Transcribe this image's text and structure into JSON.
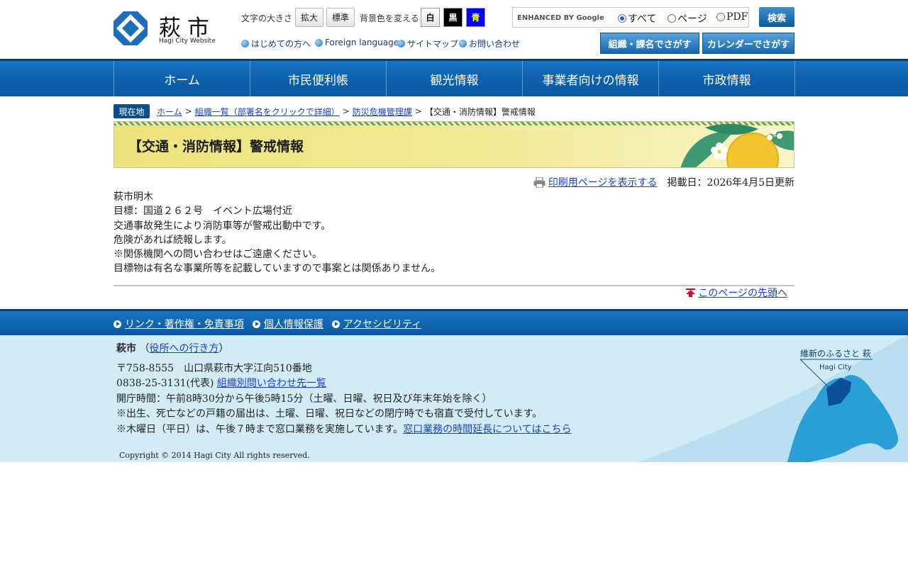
{
  "site": {
    "logo_name": "萩市",
    "logo_sub": "Hagi City Website"
  },
  "toolbar": {
    "font_size_label": "文字の大きさ",
    "enlarge": "拡大",
    "standard": "標準",
    "bg_color_label": "背景色を変える",
    "white": "白",
    "black": "黒",
    "blue": "青"
  },
  "search": {
    "placeholder": "ENHANCED BY Google",
    "scope_all": "すべて",
    "scope_page": "ページ",
    "scope_pdf": "PDF",
    "button": "検索"
  },
  "sub_links": {
    "first_time": "はじめての方へ",
    "foreign": "Foreign language",
    "sitemap": "サイトマップ",
    "contact": "お問い合わせ"
  },
  "big_buttons": {
    "org": "組織・課名でさがす",
    "calendar": "カレンダーでさがす"
  },
  "gnav": [
    "ホーム",
    "市民便利帳",
    "観光情報",
    "事業者向けの情報",
    "市政情報"
  ],
  "breadcrumb": {
    "badge": "現在地",
    "home": "ホーム",
    "org_list": "組織一覧（部署名をクリックで詳細）",
    "dept": "防災危機管理課",
    "current": "【交通・消防情報】警戒情報",
    "sep": ">"
  },
  "page": {
    "title": "【交通・消防情報】警戒情報",
    "print_link": "印刷用ページを表示する",
    "updated": "掲載日：2026年4月5日更新",
    "body": [
      "萩市明木",
      "目標：国道２６２号　イベント広場付近",
      "交通事故発生により消防車等が警戒出動中です。",
      "危険があれば続報します。",
      "※関係機関への問い合わせはご遠慮ください。",
      "目標物は有名な事業所等を記載していますので事案とは関係ありません。"
    ],
    "to_top": "このページの先頭へ"
  },
  "footer_nav": {
    "link1": "リンク・著作権・免責事項",
    "link2": "個人情報保護",
    "link3": "アクセシビリティ"
  },
  "footer": {
    "org": "萩市",
    "access_open": "（",
    "access_link": "役所への行き方",
    "access_close": "）",
    "address": "〒758-8555　山口県萩市大字江向510番地",
    "phone": "0838-25-3131(代表) ",
    "phone_link": "組織別問い合わせ先一覧",
    "hours": "開庁時間：午前8時30分から午後5時15分（土曜、日曜、祝日及び年末年始を除く）",
    "note1": "※出生、死亡などの戸籍の届出は、土曜、日曜、祝日などの閉庁時でも宿直で受付しています。",
    "note2": "※木曜日（平日）は、午後７時まで窓口業務を実施しています。",
    "note2_link": "窓口業務の時間延長についてはこちら",
    "map_title": "維新のふるさと 萩",
    "map_sub": "Hagi City",
    "copyright": "Copyright © 2014 Hagi City All rights reserved."
  },
  "colors": {
    "nav_blue": "#0e62ae",
    "footer_bg": "#d3ebf5",
    "banner_yellow": "#ede37c",
    "link": "#1a3fd6"
  }
}
